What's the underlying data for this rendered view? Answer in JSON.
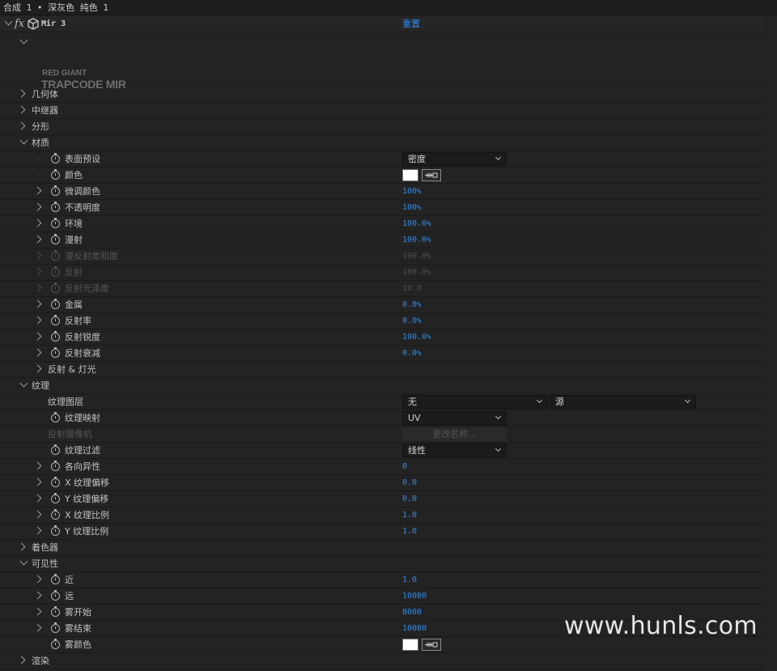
{
  "header": {
    "breadcrumb": "合成 1 • 深灰色 纯色 1"
  },
  "effect": {
    "name": "Mir 3",
    "reset_label": "重置",
    "logo_line1": "RED GIANT",
    "logo_line2": "TRAPCODE MIR"
  },
  "groups": {
    "geometry": "几何体",
    "repeater": "中继器",
    "fractal": "分形",
    "material": "材质",
    "reflect_light": "反射 & 灯光",
    "texture": "纹理",
    "shader": "着色器",
    "visibility": "可见性",
    "render": "渲染"
  },
  "material": {
    "surface_preset": {
      "label": "表面预设",
      "value": "密度"
    },
    "color": {
      "label": "颜色",
      "value": "#ffffff"
    },
    "tint_color": {
      "label": "微调颜色",
      "num": "100",
      "unit": "%"
    },
    "opacity": {
      "label": "不透明度",
      "num": "100",
      "unit": "%"
    },
    "ambient": {
      "label": "环境",
      "num": "100.0",
      "unit": "%"
    },
    "diffuse": {
      "label": "漫射",
      "num": "100.0",
      "unit": "%"
    },
    "diffuse_sat": {
      "label": "漫反射类和度",
      "num": "100.0",
      "unit": "%"
    },
    "reflect": {
      "label": "反射",
      "num": "100.0",
      "unit": "%"
    },
    "reflect_gloss": {
      "label": "反射光泽度",
      "num": "10.0",
      "unit": ""
    },
    "metal": {
      "label": "金属",
      "num": "0.0",
      "unit": "%"
    },
    "reflectivity": {
      "label": "反射率",
      "num": "0.0",
      "unit": "%"
    },
    "reflect_sharp": {
      "label": "反射锐度",
      "num": "100.0",
      "unit": "%"
    },
    "reflect_falloff": {
      "label": "反射衰减",
      "num": "0.0",
      "unit": "%"
    }
  },
  "texture": {
    "layer": {
      "label": "纹理图层",
      "value": "无",
      "value2": "源"
    },
    "mapping": {
      "label": "纹理映射",
      "value": "UV"
    },
    "camera": {
      "label": "投射摄像机",
      "button": "更改名称..."
    },
    "filter": {
      "label": "纹理过滤",
      "value": "线性"
    },
    "aniso": {
      "label": "各向异性",
      "num": "0"
    },
    "x_offset": {
      "label": "X 纹理偏移",
      "num": "0.0"
    },
    "y_offset": {
      "label": "Y 纹理偏移",
      "num": "0.0"
    },
    "x_scale": {
      "label": "X 纹理比例",
      "num": "1.0"
    },
    "y_scale": {
      "label": "Y 纹理比例",
      "num": "1.0"
    }
  },
  "visibility": {
    "near": {
      "label": "近",
      "num": "1.0"
    },
    "far": {
      "label": "远",
      "num": "10000"
    },
    "fog_start": {
      "label": "雾开始",
      "num": "8000"
    },
    "fog_end": {
      "label": "雾结束",
      "num": "10000"
    },
    "fog_color": {
      "label": "雾颜色",
      "value": "#ffffff"
    }
  },
  "watermark": "www.hunls.com"
}
